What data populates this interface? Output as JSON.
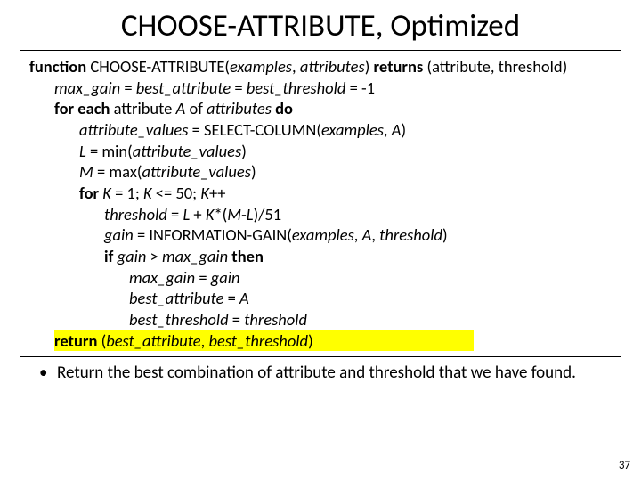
{
  "title": "CHOOSE-ATTRIBUTE, Optimized",
  "code": {
    "l1a": "function",
    "l1b": " CHOOSE-ATTRIBUTE(",
    "l1c": "examples",
    "l1d": ", ",
    "l1e": "attributes",
    "l1f": ") ",
    "l1g": "returns",
    "l1h": " (attribute, threshold)",
    "l2a": "max_gain",
    "l2b": " = ",
    "l2c": "best_attribute",
    "l2d": " = ",
    "l2e": "best_threshold",
    "l2f": " = -1",
    "l3a": "for each",
    "l3b": " attribute ",
    "l3c": "A",
    "l3d": " of ",
    "l3e": "attributes",
    "l3f": " do",
    "l4a": "attribute_values",
    "l4b": " = SELECT-COLUMN(",
    "l4c": "examples",
    "l4d": ", ",
    "l4e": "A",
    "l4f": ")",
    "l5a": "L",
    "l5b": " = min(",
    "l5c": "attribute_values",
    "l5d": ")",
    "l6a": "M",
    "l6b": " = max(",
    "l6c": "attribute_values",
    "l6d": ")",
    "l7a": "for",
    "l7b": " K",
    "l7c": " = 1; ",
    "l7d": "K",
    "l7e": " <= 50; ",
    "l7f": "K",
    "l7g": "++",
    "l8a": "threshold",
    "l8b": " = ",
    "l8c": "L",
    "l8d": " + ",
    "l8e": "K",
    "l8f": "*(",
    "l8g": "M",
    "l8h": "-",
    "l8i": "L",
    "l8j": ")/51",
    "l9a": "gain",
    "l9b": " = INFORMATION-GAIN(",
    "l9c": "examples",
    "l9d": ", ",
    "l9e": "A",
    "l9f": ", ",
    "l9g": "threshold",
    "l9h": ")",
    "l10a": "if",
    "l10b": " gain",
    "l10c": " > ",
    "l10d": "max_gain",
    "l10e": " then",
    "l11a": "max_gain",
    "l11b": " = ",
    "l11c": "gain",
    "l12a": "best_attribute",
    "l12b": " = ",
    "l12c": "A",
    "l13a": "best_threshold",
    "l13b": " = ",
    "l13c": "threshold",
    "l14a": "return",
    "l14b": " (",
    "l14c": "best_attribute",
    "l14d": ", ",
    "l14e": "best_threshold",
    "l14f": ")"
  },
  "bullet": {
    "dot": "•",
    "text": "Return the best combination of attribute and threshold that we have found."
  },
  "pageno": "37"
}
